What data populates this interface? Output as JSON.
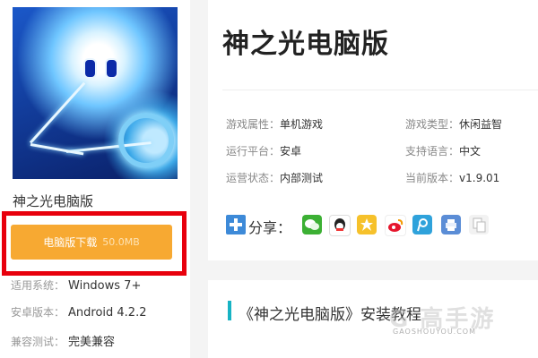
{
  "sidebar": {
    "game_name": "神之光电脑版",
    "download_label": "电脑版下载",
    "download_size": "50.0MB",
    "specs": [
      {
        "label": "适用系统：",
        "value": "Windows 7+"
      },
      {
        "label": "安卓版本：",
        "value": "Android 4.2.2"
      },
      {
        "label": "兼容测试：",
        "value": "完美兼容"
      }
    ]
  },
  "main": {
    "title": "神之光电脑版",
    "attributes": [
      {
        "label": "游戏属性：",
        "value": "单机游戏"
      },
      {
        "label": "游戏类型：",
        "value": "休闲益智"
      },
      {
        "label": "运行平台：",
        "value": "安卓"
      },
      {
        "label": "支持语言：",
        "value": "中文"
      },
      {
        "label": "运营状态：",
        "value": "内部测试"
      },
      {
        "label": "当前版本：",
        "value": "v1.9.01"
      }
    ],
    "share_label": "分享：",
    "share_icons": [
      "wechat-icon",
      "qq-icon",
      "qzone-icon",
      "weibo-icon",
      "tencent-weibo-icon",
      "print-icon",
      "copy-icon"
    ]
  },
  "section": {
    "title": "《神之光电脑版》安装教程"
  },
  "watermark": {
    "logo": "G 高手游",
    "url": "GAOSHOUYOU.COM"
  },
  "colors": {
    "download_button": "#f7a932",
    "highlight_box": "#e8000d",
    "section_bar": "#17b3c4"
  }
}
